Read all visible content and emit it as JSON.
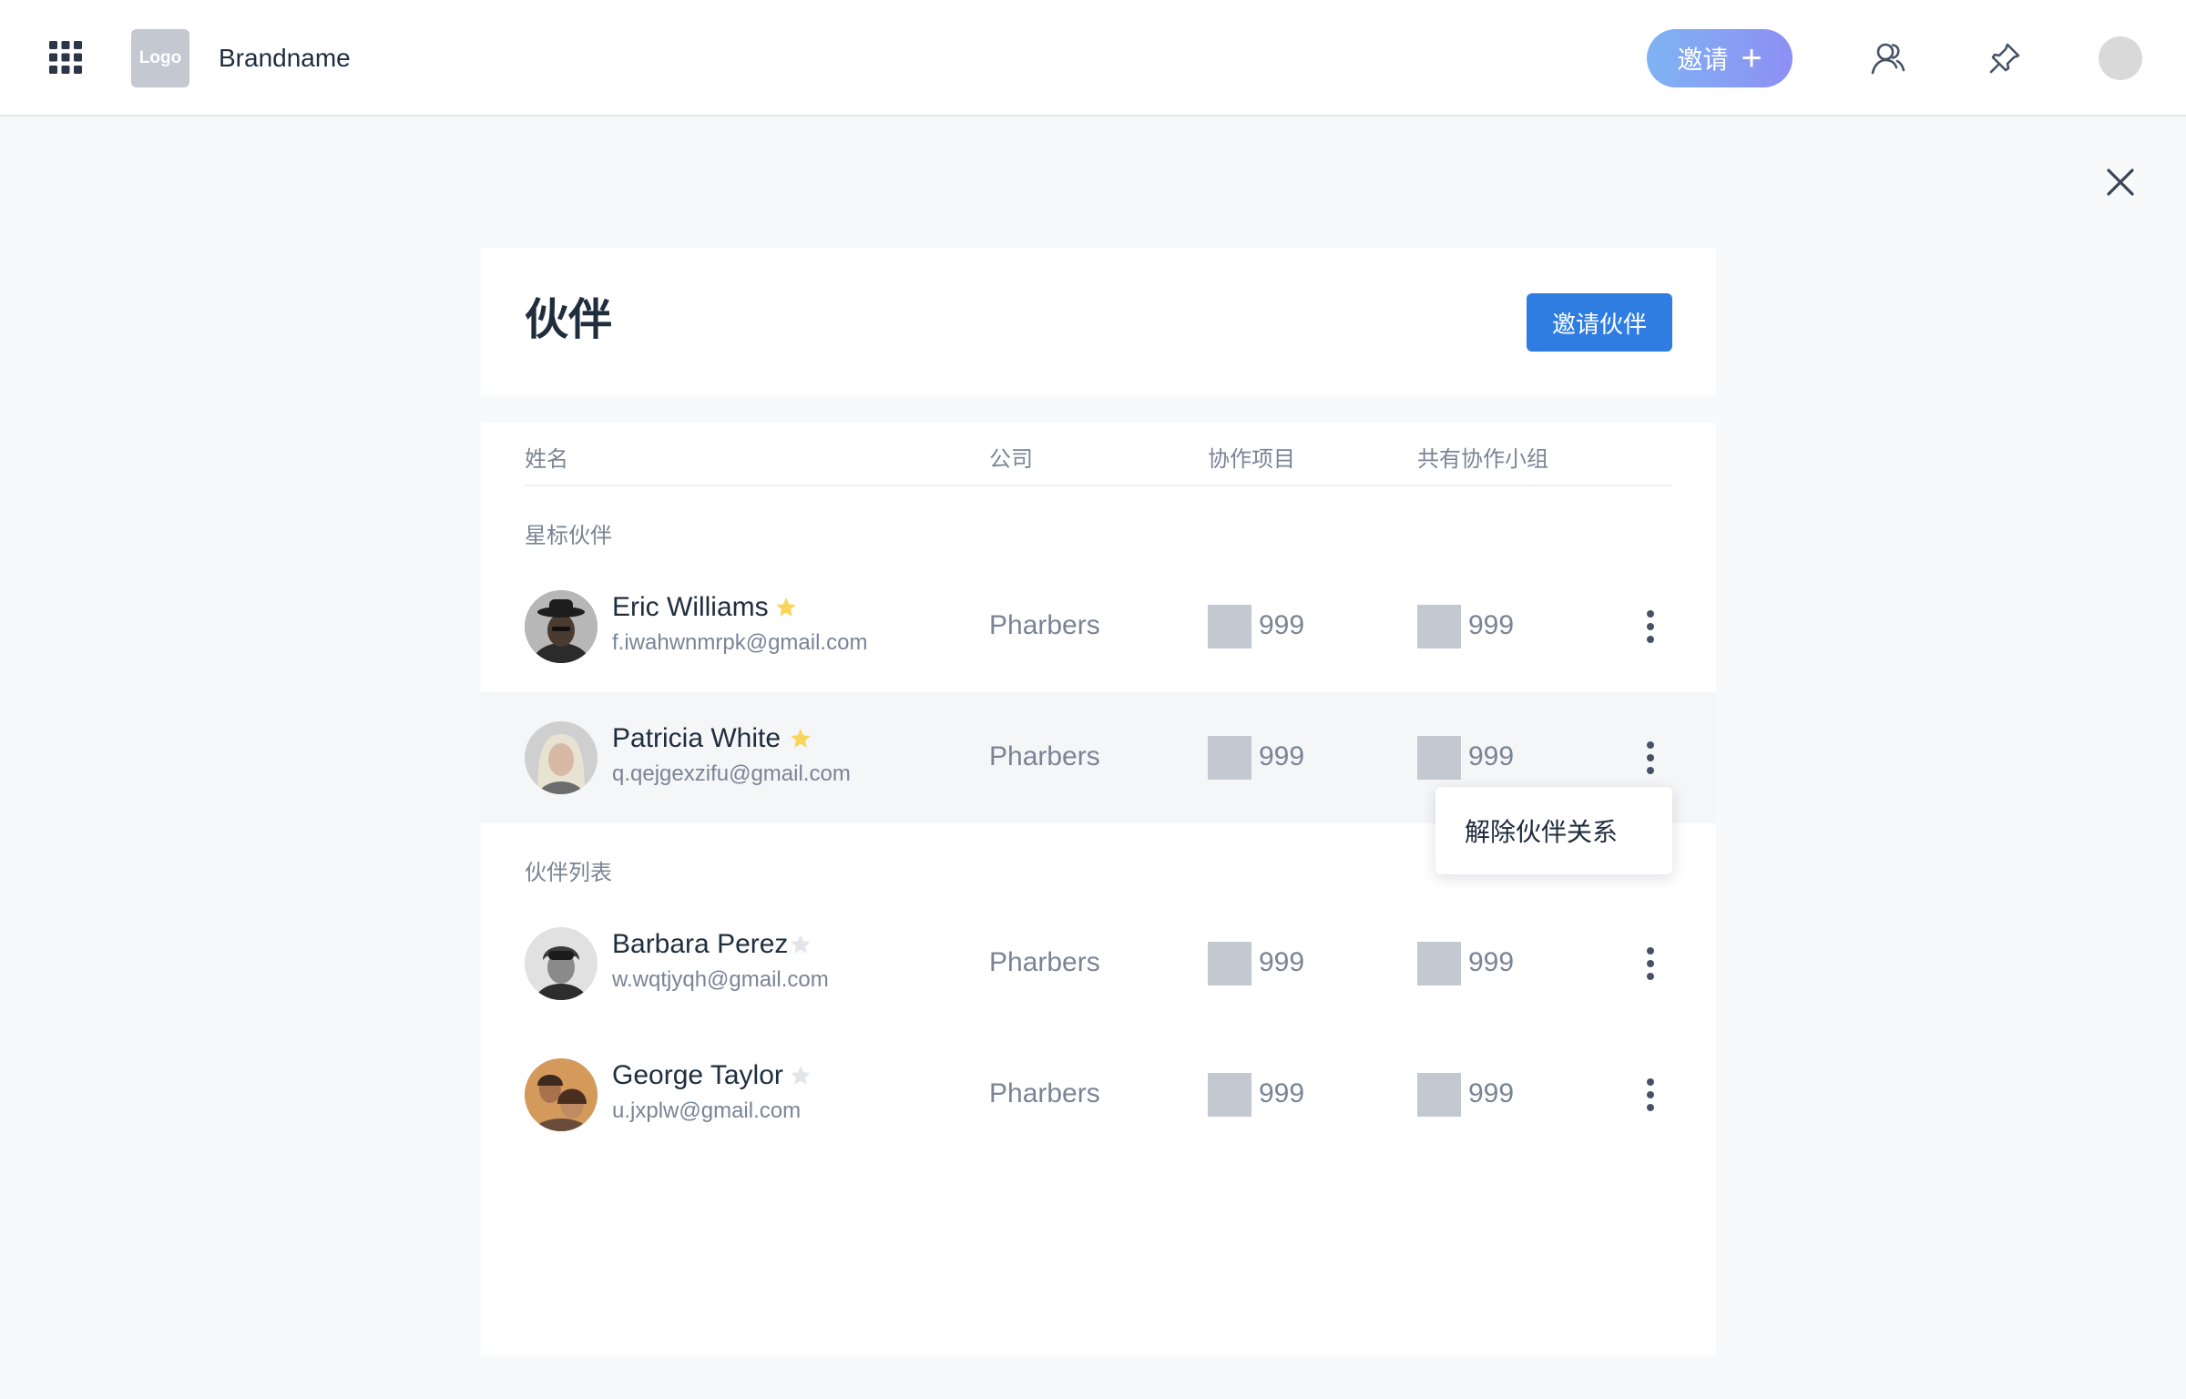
{
  "header": {
    "logo_text": "Logo",
    "brand_name": "Brandname",
    "invite_label": "邀请",
    "invite_plus": "+",
    "invite_gradient": [
      "#7fb3f3",
      "#8d8ff4"
    ],
    "icons": [
      "apps-grid-icon",
      "people-icon",
      "pin-icon"
    ]
  },
  "page": {
    "title": "伙伴",
    "invite_partner_label": "邀请伙伴",
    "accent": "#2f7de1"
  },
  "table": {
    "columns": {
      "name": "姓名",
      "company": "公司",
      "projects": "协作项目",
      "groups": "共有协作小组"
    },
    "starred_section_label": "星标伙伴",
    "list_section_label": "伙伴列表",
    "starred": [
      {
        "name": "Eric Williams",
        "email": "f.iwahwnmrpk@gmail.com",
        "company": "Pharbers",
        "projects": "999",
        "groups": "999",
        "starred": true
      },
      {
        "name": "Patricia White",
        "email": "q.qejgexzifu@gmail.com",
        "company": "Pharbers",
        "projects": "999",
        "groups": "999",
        "starred": true
      }
    ],
    "partners": [
      {
        "name": "Barbara Perez",
        "email": "w.wqtjyqh@gmail.com",
        "company": "Pharbers",
        "projects": "999",
        "groups": "999",
        "starred": false
      },
      {
        "name": "George Taylor",
        "email": "u.jxplw@gmail.com",
        "company": "Pharbers",
        "projects": "999",
        "groups": "999",
        "starred": false
      }
    ]
  },
  "dropdown": {
    "remove_partner_label": "解除伙伴关系"
  },
  "colors": {
    "star_active": "#f8d65a",
    "star_inactive": "#e3e5e9"
  }
}
